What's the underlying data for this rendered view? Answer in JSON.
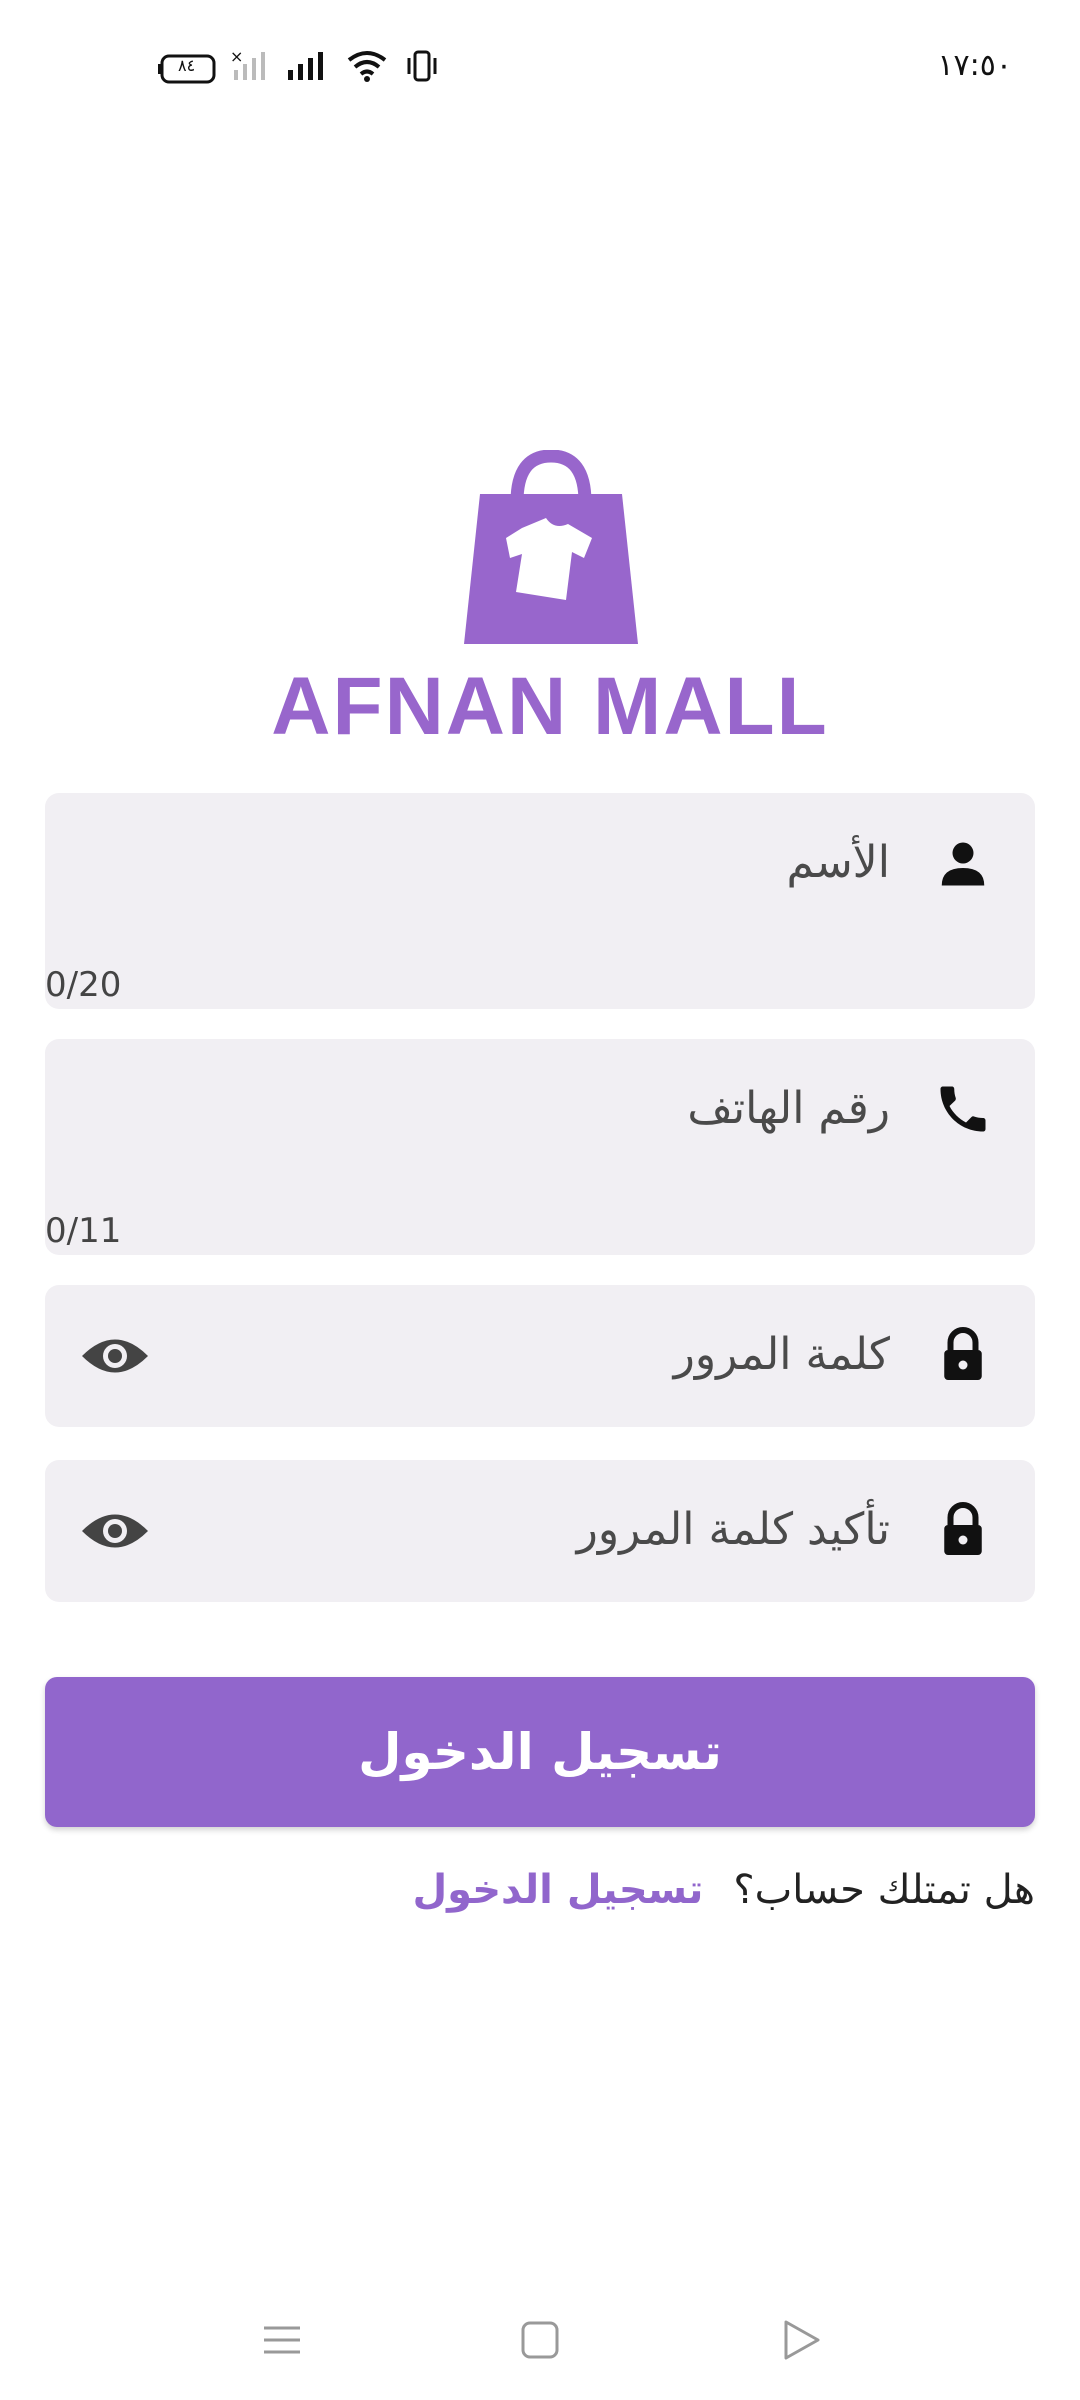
{
  "status_bar": {
    "time": "١٧:٥٠",
    "battery": "٨٤",
    "icons": [
      "battery-icon",
      "no-signal-icon",
      "signal-icon",
      "wifi-icon",
      "vibrate-icon"
    ]
  },
  "logo": {
    "text": "AFNAN MALL",
    "color": "#9866cc"
  },
  "form": {
    "name_label": "الأسم",
    "name_counter": "0/20",
    "phone_label": "رقم الهاتف",
    "phone_counter": "0/11",
    "password_label": "كلمة المرور",
    "confirm_password_label": "تأكيد كلمة المرور",
    "submit_label": "تسجيل الدخول"
  },
  "footer": {
    "question": "هل تمتلك حساب؟",
    "login_link": "تسجيل الدخول"
  },
  "colors": {
    "accent": "#9166cc",
    "field_bg": "#f1eff3"
  },
  "nav": {
    "icons": [
      "menu-icon",
      "home-icon",
      "back-icon"
    ]
  }
}
